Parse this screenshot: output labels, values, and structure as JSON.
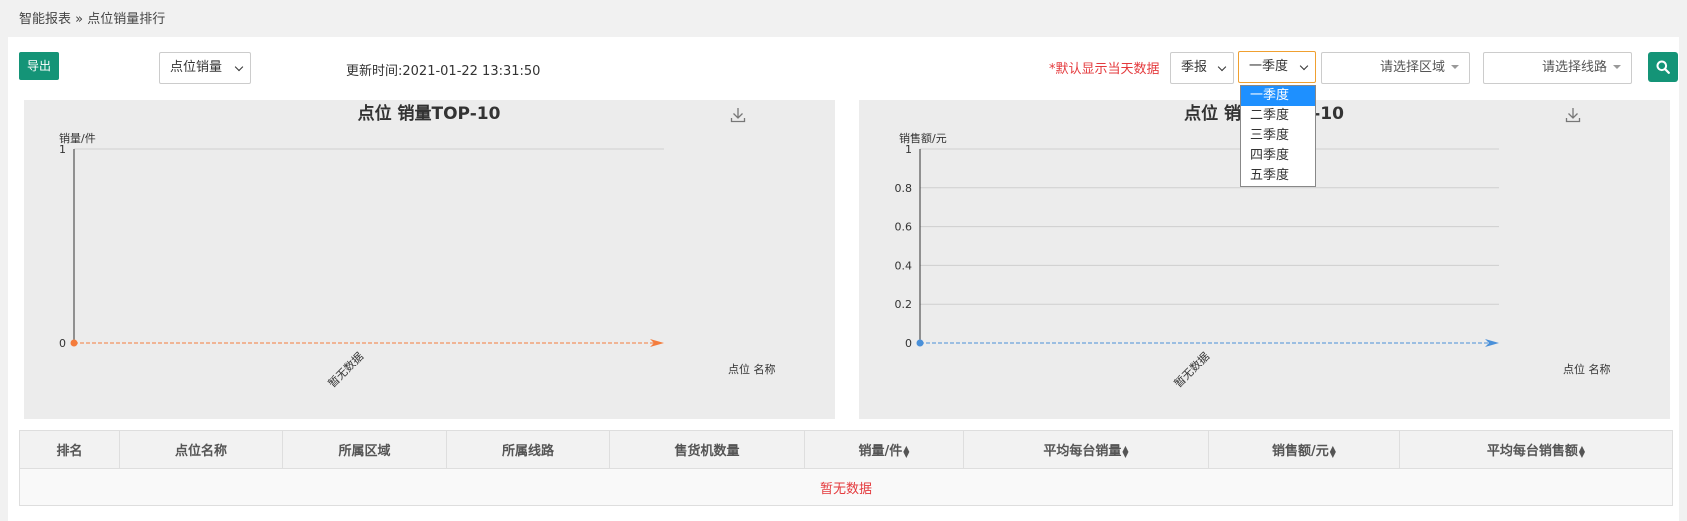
{
  "breadcrumb": "智能报表 » 点位销量排行",
  "toolbar": {
    "export_label": "导出",
    "metric_select": "点位销量",
    "update_time": "更新时间:2021-01-22 13:31:50",
    "notice": "*默认显示当天数据",
    "period_select": "季报",
    "quarter_select": "一季度",
    "region_placeholder": "请选择区域",
    "route_placeholder": "请选择线路"
  },
  "quarter_options": [
    "一季度",
    "二季度",
    "三季度",
    "四季度",
    "五季度"
  ],
  "colors": {
    "accent": "#149477",
    "notice": "#e4393c",
    "left_axis": "#f47c3c",
    "right_axis": "#4a90d9",
    "selected": "#1e90ff"
  },
  "chart_data": [
    {
      "type": "bar",
      "title": "点位 销量TOP-10",
      "xlabel": "点位 名称",
      "ylabel": "销量/件",
      "categories": [
        "暂无数据"
      ],
      "yticks": [
        "0",
        "1"
      ],
      "ylim": [
        0,
        1
      ],
      "values": [
        0
      ]
    },
    {
      "type": "bar",
      "title": "点位 销售额TOP-10",
      "xlabel": "点位 名称",
      "ylabel": "销售额/元",
      "categories": [
        "暂无数据"
      ],
      "yticks": [
        "0",
        "0.2",
        "0.4",
        "0.6",
        "0.8",
        "1"
      ],
      "ylim": [
        0,
        1
      ],
      "values": [
        0
      ]
    }
  ],
  "table": {
    "headers": [
      "排名",
      "点位名称",
      "所属区域",
      "所属线路",
      "售货机数量",
      "销量/件",
      "平均每台销量",
      "销售额/元",
      "平均每台销售额"
    ],
    "empty_text": "暂无数据"
  }
}
